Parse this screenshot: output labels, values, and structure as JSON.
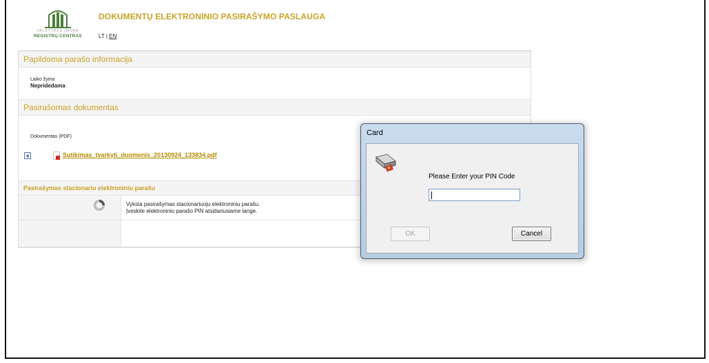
{
  "header": {
    "logo_small_text": "VALSTYBĖS ĮMONĖ",
    "logo_name": "REGISTRŲ CENTRAS",
    "title": "DOKUMENTŲ ELEKTRONINIO PASIRAŠYMO PASLAUGA",
    "lang_lt": "LT",
    "lang_sep": " | ",
    "lang_en": "EN"
  },
  "signature_info": {
    "heading": "Papildoma parašo informacija",
    "timestamp_label": "Laiko žyma",
    "timestamp_value": "Nepridedama"
  },
  "document": {
    "heading": "Pasirašomas dokumentas",
    "label": "Dokumentas (PDF)",
    "filename": "Sutikimas_tvarkyti_duomenis_20130924_133834.pdf"
  },
  "signing": {
    "heading": "Pasirašymas stacionariu elektroniniu parašu",
    "message_line1": "Vyksta pasirašymas stacionariuoju elektroniniu parašu.",
    "message_line2": "Įveskite elektroninio parašo PIN atsidariusiame lange."
  },
  "dialog": {
    "title": "Card",
    "prompt": "Please Enter your PIN Code",
    "pin_value": "",
    "ok_label": "OK",
    "cancel_label": "Cancel"
  },
  "icons": {
    "logo": "registru-centras-pillars-logo",
    "expand": "plus-expand-icon",
    "pdf": "pdf-file-icon",
    "spinner": "loading-spinner-icon",
    "card_reader": "smart-card-reader-icon"
  },
  "colors": {
    "accent_gold": "#c9a227",
    "link_gold": "#b38b00",
    "logo_green": "#4e7d3c",
    "dialog_frame": "#b7cde3"
  }
}
